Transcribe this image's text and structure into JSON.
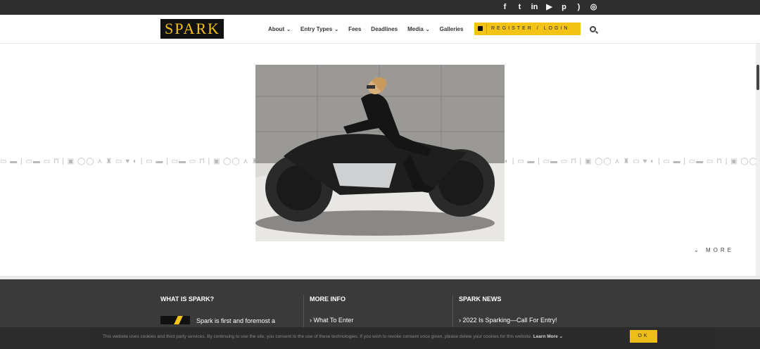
{
  "topbar": {
    "social": [
      {
        "icon": "facebook-icon",
        "glyph": "f"
      },
      {
        "icon": "twitter-icon",
        "glyph": "t"
      },
      {
        "icon": "linkedin-icon",
        "glyph": "in"
      },
      {
        "icon": "youtube-icon",
        "glyph": "▶"
      },
      {
        "icon": "pinterest-icon",
        "glyph": "p"
      },
      {
        "icon": "rss-icon",
        "glyph": ")"
      },
      {
        "icon": "instagram-icon",
        "glyph": "◎"
      }
    ]
  },
  "header": {
    "logo_text": "SPARK",
    "nav": [
      {
        "label": "About",
        "dropdown": true
      },
      {
        "label": "Entry Types",
        "dropdown": true
      },
      {
        "label": "Fees",
        "dropdown": false
      },
      {
        "label": "Deadlines",
        "dropdown": false
      },
      {
        "label": "Media",
        "dropdown": true
      },
      {
        "label": "Galleries",
        "dropdown": false
      }
    ],
    "register_label": "REGISTER / LOGIN"
  },
  "hero": {
    "more_label": "MORE"
  },
  "footer": {
    "col1": {
      "heading": "WHAT IS SPARK?",
      "text": "Spark is first and foremost a"
    },
    "col2": {
      "heading": "MORE INFO",
      "text": "› What To Enter"
    },
    "col3": {
      "heading": "SPARK NEWS",
      "text": "› 2022 Is Sparking—Call For Entry!"
    }
  },
  "cookie": {
    "text": "This website uses cookies and third party services. By continuing to use the site, you consent to the use of these technologies. If you wish to revoke consent once given, please delete your cookies for this website.",
    "learn_more": "Learn More ⌄",
    "ok_label": "OK"
  },
  "colors": {
    "accent": "#f3c316",
    "dark": "#2e2e2e",
    "footer": "#3a3a3a"
  }
}
